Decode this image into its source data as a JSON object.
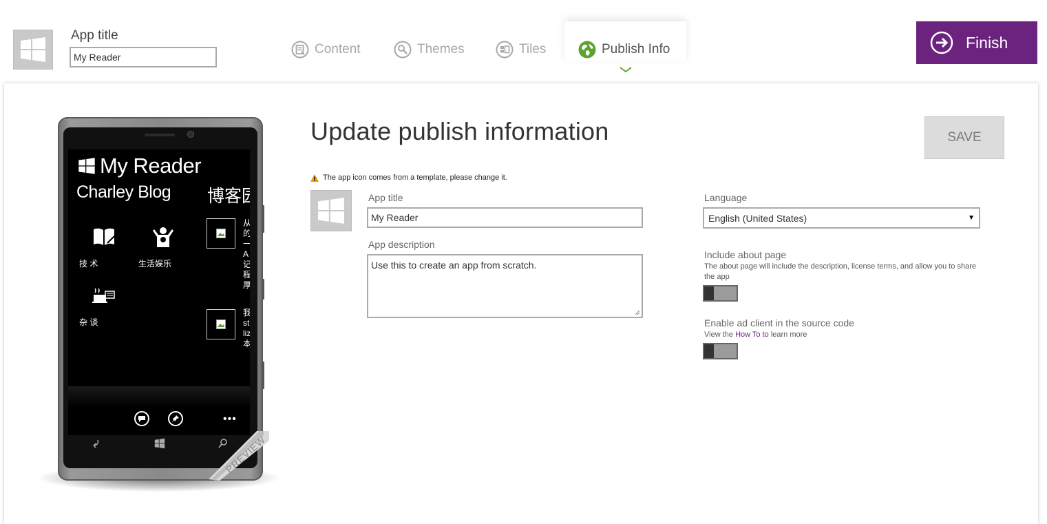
{
  "header": {
    "app_title_label": "App title",
    "app_title_value": "My Reader",
    "tabs": [
      {
        "label": "Content",
        "icon": "content-icon"
      },
      {
        "label": "Themes",
        "icon": "themes-icon"
      },
      {
        "label": "Tiles",
        "icon": "tiles-icon"
      },
      {
        "label": "Publish Info",
        "icon": "globe-icon"
      }
    ],
    "finish_label": "Finish"
  },
  "preview": {
    "app_name": "My Reader",
    "category_title": "Charley Blog",
    "category_title_2": "博客园",
    "items": [
      {
        "label": "技 术",
        "icon": "book-icon"
      },
      {
        "label": "生活娱乐",
        "icon": "person-cheer-icon"
      },
      {
        "label": "杂 谈",
        "icon": "coffee-icon"
      }
    ],
    "side_text_1": "从的一A记程厚",
    "side_text_2": "我stliz本",
    "ribbon": "PREVIEW"
  },
  "form": {
    "heading": "Update publish information",
    "save_label": "SAVE",
    "warning": "The app icon comes from a template, please change it.",
    "app_title_label": "App title",
    "app_title_value": "My Reader",
    "app_description_label": "App description",
    "app_description_value": "Use this to create an app from scratch.",
    "language_label": "Language",
    "language_value": "English (United States)",
    "about_label": "Include about page",
    "about_desc": "The about page will include the description, license terms, and allow you to share the app",
    "about_on": false,
    "ad_label": "Enable ad client in the source code",
    "ad_desc_prefix": "View the",
    "ad_desc_link": "How To to",
    "ad_desc_suffix": "learn more",
    "ad_on": false
  },
  "colors": {
    "accent": "#6c2380",
    "publish_green": "#5fa32f",
    "tab_inactive": "#a8a8a8"
  }
}
